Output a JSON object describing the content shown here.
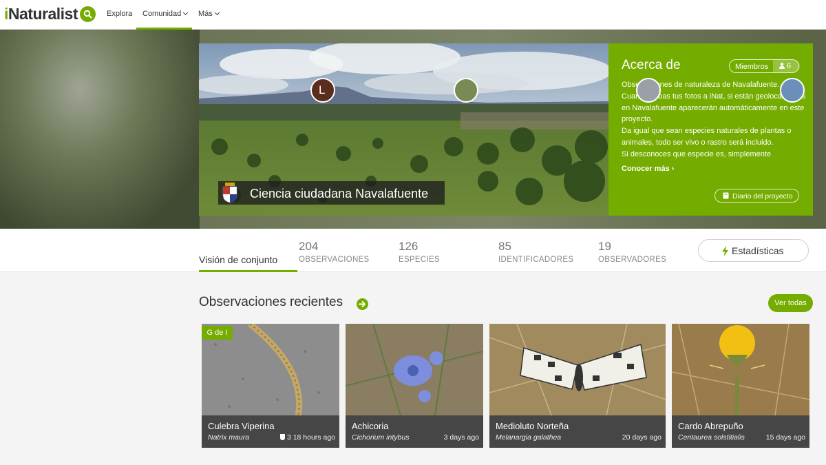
{
  "nav": {
    "logo_i": "i",
    "logo_rest": "Naturalist",
    "explore": "Explora",
    "community": "Comunidad",
    "more": "Más",
    "search_icon": "search-icon"
  },
  "project": {
    "title": "Ciencia ciudadana Navalafuente",
    "about_title": "Acerca de",
    "members_label": "Miembros",
    "members_count": "6",
    "description": [
      "Observaciones de naturaleza de Navalafuente.",
      "Cuando subas tus fotos a iNat, si están geolocalizadas en Navalafuente aparecerán automáticamente en este proyecto.",
      "Da igual que sean especies naturales de plantas o animales, todo ser vivo o rastro será incluido.",
      "Si desconoces que especie es, simplemente"
    ],
    "learn_more": "Conocer más ›",
    "journal": "Diario del proyecto"
  },
  "stats": {
    "overview_tab": "Visión de conjunto",
    "items": [
      {
        "value": "204",
        "label": "OBSERVACIONES"
      },
      {
        "value": "126",
        "label": "ESPECIES"
      },
      {
        "value": "85",
        "label": "IDENTIFICADORES"
      },
      {
        "value": "19",
        "label": "OBSERVADORES"
      }
    ],
    "stats_button": "Estadísticas"
  },
  "recent": {
    "title": "Observaciones recientes",
    "view_all": "Ver todas",
    "observations": [
      {
        "common": "Culebra Viperina",
        "scientific": "Natrix maura",
        "when": "3 18 hours ago",
        "badge": "G de I",
        "avatar_letter": "L"
      },
      {
        "common": "Achicoria",
        "scientific": "Cichorium intybus",
        "when": "3 days ago"
      },
      {
        "common": "Medioluto Norteña",
        "scientific": "Melanargia galathea",
        "when": "20 days ago"
      },
      {
        "common": "Cardo Abrepuño",
        "scientific": "Centaurea solstitialis",
        "when": "15 days ago"
      }
    ]
  },
  "colors": {
    "accent": "#74ac00",
    "card_meta": "#464646"
  }
}
